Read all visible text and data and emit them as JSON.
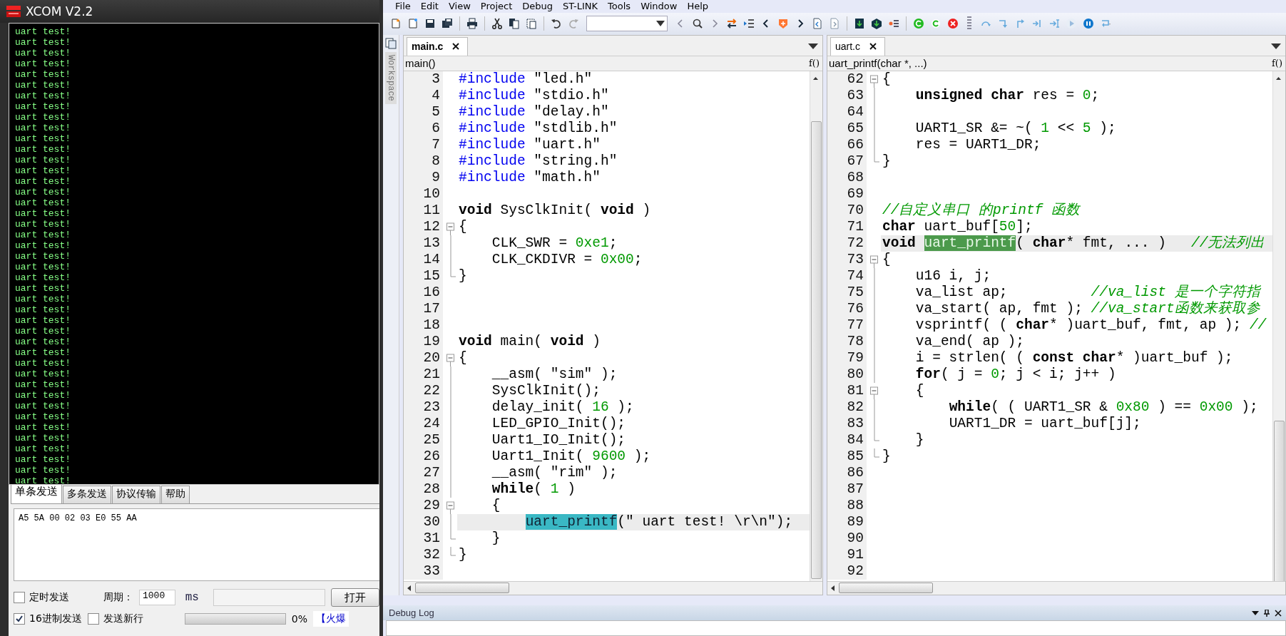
{
  "xcom": {
    "title": "XCOM V2.2",
    "terminal_lines": [
      "uart test!",
      "uart test!",
      "uart test!",
      "uart test!",
      "uart test!",
      "uart test!",
      "uart test!",
      "uart test!",
      "uart test!",
      "uart test!",
      "uart test!",
      "uart test!",
      "uart test!",
      "uart test!",
      "uart test!",
      "uart test!",
      "uart test!",
      "uart test!",
      "uart test!",
      "uart test!",
      "uart test!",
      "uart test!",
      "uart test!",
      "uart test!",
      "uart test!",
      "uart test!",
      "uart test!",
      "uart test!",
      "uart test!",
      "uart test!",
      "uart test!",
      "uart test!",
      "uart test!",
      "uart test!",
      "uart test!",
      "uart test!",
      "uart test!",
      "uart test!",
      "uart test!",
      "uart test!",
      "uart test!",
      "uart test!",
      "uart test!"
    ],
    "tabs": [
      {
        "label": "单条发送",
        "selected": true
      },
      {
        "label": "多条发送",
        "selected": false
      },
      {
        "label": "协议传输",
        "selected": false
      },
      {
        "label": "帮助",
        "selected": false
      }
    ],
    "send_text": "A5 5A 00 02 03 E0 55 AA",
    "timed_send": {
      "label": "定时发送",
      "checked": false
    },
    "period_label": "周期：",
    "period_value": "1000",
    "period_unit": "ms",
    "open_file_button": "打开",
    "hex_send": {
      "label": "16进制发送",
      "checked": true
    },
    "send_newline": {
      "label": "发送新行",
      "checked": false
    },
    "progress": {
      "level": 0,
      "reading": "0%"
    },
    "link": "【火爆"
  },
  "ide": {
    "menu": [
      "File",
      "Edit",
      "View",
      "Project",
      "Debug",
      "ST-LINK",
      "Tools",
      "Window",
      "Help"
    ],
    "workspace_label": "Workspace",
    "editors": [
      {
        "tab": {
          "label": "main.c",
          "selected": true
        },
        "function": "main()",
        "func_button": "f()",
        "lines": [
          {
            "no": "3",
            "kind": "plain",
            "segs": [
              {
                "kind": "pp",
                "text": "#include"
              },
              {
                "kind": "plain",
                "text": " \"led.h\""
              }
            ]
          },
          {
            "no": "4",
            "kind": "plain",
            "segs": [
              {
                "kind": "pp",
                "text": "#include"
              },
              {
                "kind": "plain",
                "text": " \"stdio.h\""
              }
            ]
          },
          {
            "no": "5",
            "kind": "plain",
            "segs": [
              {
                "kind": "pp",
                "text": "#include"
              },
              {
                "kind": "plain",
                "text": " \"delay.h\""
              }
            ]
          },
          {
            "no": "6",
            "kind": "plain",
            "segs": [
              {
                "kind": "pp",
                "text": "#include"
              },
              {
                "kind": "plain",
                "text": " \"stdlib.h\""
              }
            ]
          },
          {
            "no": "7",
            "kind": "plain",
            "segs": [
              {
                "kind": "pp",
                "text": "#include"
              },
              {
                "kind": "plain",
                "text": " \"uart.h\""
              }
            ]
          },
          {
            "no": "8",
            "kind": "plain",
            "segs": [
              {
                "kind": "pp",
                "text": "#include"
              },
              {
                "kind": "plain",
                "text": " \"string.h\""
              }
            ]
          },
          {
            "no": "9",
            "kind": "plain",
            "segs": [
              {
                "kind": "pp",
                "text": "#include"
              },
              {
                "kind": "plain",
                "text": " \"math.h\""
              }
            ]
          },
          {
            "no": "10",
            "kind": "plain"
          },
          {
            "no": "11",
            "kind": "plain",
            "segs": [
              {
                "kind": "kw",
                "text": "void"
              },
              {
                "kind": "plain",
                "text": " SysClkInit( "
              },
              {
                "kind": "kw",
                "text": "void"
              },
              {
                "kind": "plain",
                "text": " )"
              }
            ]
          },
          {
            "no": "12",
            "kind": "opener",
            "segs": [
              {
                "kind": "plain",
                "text": "{"
              }
            ]
          },
          {
            "no": "13",
            "kind": "inner",
            "segs": [
              {
                "kind": "plain",
                "text": "    CLK_SWR = "
              },
              {
                "kind": "num",
                "text": "0xe1"
              },
              {
                "kind": "plain",
                "text": ";"
              }
            ]
          },
          {
            "no": "14",
            "kind": "inner",
            "segs": [
              {
                "kind": "plain",
                "text": "    CLK_CKDIVR = "
              },
              {
                "kind": "num",
                "text": "0x00"
              },
              {
                "kind": "plain",
                "text": ";"
              }
            ]
          },
          {
            "no": "15",
            "kind": "closer",
            "segs": [
              {
                "kind": "plain",
                "text": "}"
              }
            ]
          },
          {
            "no": "16",
            "kind": "plain"
          },
          {
            "no": "17",
            "kind": "plain"
          },
          {
            "no": "18",
            "kind": "plain"
          },
          {
            "no": "19",
            "kind": "plain",
            "segs": [
              {
                "kind": "kw",
                "text": "void"
              },
              {
                "kind": "plain",
                "text": " main( "
              },
              {
                "kind": "kw",
                "text": "void"
              },
              {
                "kind": "plain",
                "text": " )"
              }
            ]
          },
          {
            "no": "20",
            "kind": "opener",
            "segs": [
              {
                "kind": "plain",
                "text": "{"
              }
            ]
          },
          {
            "no": "21",
            "kind": "inner",
            "segs": [
              {
                "kind": "plain",
                "text": "    __asm( \"sim\" );"
              }
            ]
          },
          {
            "no": "22",
            "kind": "inner",
            "segs": [
              {
                "kind": "plain",
                "text": "    SysClkInit();"
              }
            ]
          },
          {
            "no": "23",
            "kind": "inner",
            "segs": [
              {
                "kind": "plain",
                "text": "    delay_init( "
              },
              {
                "kind": "num",
                "text": "16"
              },
              {
                "kind": "plain",
                "text": " );"
              }
            ]
          },
          {
            "no": "24",
            "kind": "inner",
            "segs": [
              {
                "kind": "plain",
                "text": "    LED_GPIO_Init();"
              }
            ]
          },
          {
            "no": "25",
            "kind": "inner",
            "segs": [
              {
                "kind": "plain",
                "text": "    Uart1_IO_Init();"
              }
            ]
          },
          {
            "no": "26",
            "kind": "inner",
            "segs": [
              {
                "kind": "plain",
                "text": "    Uart1_Init( "
              },
              {
                "kind": "num",
                "text": "9600"
              },
              {
                "kind": "plain",
                "text": " );"
              }
            ]
          },
          {
            "no": "27",
            "kind": "inner",
            "segs": [
              {
                "kind": "plain",
                "text": "    __asm( \"rim\" );"
              }
            ]
          },
          {
            "no": "28",
            "kind": "inner",
            "segs": [
              {
                "kind": "kw",
                "text": "    while"
              },
              {
                "kind": "plain",
                "text": "( "
              },
              {
                "kind": "num",
                "text": "1"
              },
              {
                "kind": "plain",
                "text": " )"
              }
            ]
          },
          {
            "no": "29",
            "kind": "opener",
            "segs": [
              {
                "kind": "plain",
                "text": "    {"
              }
            ]
          },
          {
            "no": "30",
            "kind": "inner",
            "current": true,
            "segs": [
              {
                "kind": "match",
                "text": "        uart_printf"
              },
              {
                "kind": "plain",
                "text": "(\" uart test! \\r\\n\");"
              }
            ]
          },
          {
            "no": "31",
            "kind": "closer",
            "segs": [
              {
                "kind": "plain",
                "text": "    }"
              }
            ]
          },
          {
            "no": "32",
            "kind": "closer",
            "segs": [
              {
                "kind": "plain",
                "text": "}"
              }
            ]
          },
          {
            "no": "33",
            "kind": "plain"
          }
        ]
      },
      {
        "tab": {
          "label": "uart.c",
          "selected": true
        },
        "function": "uart_printf(char *, ...)",
        "func_button": "f()",
        "lines": [
          {
            "no": "62",
            "kind": "opener",
            "segs": [
              {
                "kind": "plain",
                "text": "{"
              }
            ]
          },
          {
            "no": "63",
            "kind": "inner",
            "segs": [
              {
                "kind": "kw",
                "text": "    unsigned char"
              },
              {
                "kind": "plain",
                "text": " res = "
              },
              {
                "kind": "num",
                "text": "0"
              },
              {
                "kind": "plain",
                "text": ";"
              }
            ]
          },
          {
            "no": "64",
            "kind": "inner"
          },
          {
            "no": "65",
            "kind": "inner",
            "segs": [
              {
                "kind": "plain",
                "text": "    UART1_SR &= ~( "
              },
              {
                "kind": "num",
                "text": "1"
              },
              {
                "kind": "plain",
                "text": " << "
              },
              {
                "kind": "num",
                "text": "5"
              },
              {
                "kind": "plain",
                "text": " );"
              }
            ]
          },
          {
            "no": "66",
            "kind": "inner",
            "segs": [
              {
                "kind": "plain",
                "text": "    res = UART1_DR;"
              }
            ]
          },
          {
            "no": "67",
            "kind": "closer",
            "segs": [
              {
                "kind": "plain",
                "text": "}"
              }
            ]
          },
          {
            "no": "68",
            "kind": "plain"
          },
          {
            "no": "69",
            "kind": "plain"
          },
          {
            "no": "70",
            "kind": "plain",
            "segs": [
              {
                "kind": "cmt",
                "text": "//自定义串口 的printf 函数"
              }
            ]
          },
          {
            "no": "71",
            "kind": "plain",
            "segs": [
              {
                "kind": "kw",
                "text": "char"
              },
              {
                "kind": "plain",
                "text": " uart_buf["
              },
              {
                "kind": "num",
                "text": "50"
              },
              {
                "kind": "plain",
                "text": "];"
              }
            ]
          },
          {
            "no": "72",
            "kind": "plain",
            "current": true,
            "segs": [
              {
                "kind": "kw",
                "text": "void"
              },
              {
                "kind": "selection",
                "text": " uart_printf"
              },
              {
                "kind": "plain",
                "text": "( "
              },
              {
                "kind": "kw",
                "text": "char"
              },
              {
                "kind": "plain",
                "text": "* fmt, ... )   "
              },
              {
                "kind": "cmt",
                "text": "//无法列出"
              }
            ]
          },
          {
            "no": "73",
            "kind": "opener",
            "segs": [
              {
                "kind": "plain",
                "text": "{"
              }
            ]
          },
          {
            "no": "74",
            "kind": "inner",
            "segs": [
              {
                "kind": "plain",
                "text": "    u16 i, j;"
              }
            ]
          },
          {
            "no": "75",
            "kind": "inner",
            "segs": [
              {
                "kind": "plain",
                "text": "    va_list ap;          "
              },
              {
                "kind": "cmt",
                "text": "//va_list 是一个字符指"
              }
            ]
          },
          {
            "no": "76",
            "kind": "inner",
            "segs": [
              {
                "kind": "plain",
                "text": "    va_start( ap, fmt ); "
              },
              {
                "kind": "cmt",
                "text": "//va_start函数来获取参"
              }
            ]
          },
          {
            "no": "77",
            "kind": "inner",
            "segs": [
              {
                "kind": "plain",
                "text": "    vsprintf( ( "
              },
              {
                "kind": "kw",
                "text": "char"
              },
              {
                "kind": "plain",
                "text": "* )uart_buf, fmt, ap ); "
              },
              {
                "kind": "cmt",
                "text": "//"
              }
            ]
          },
          {
            "no": "78",
            "kind": "inner",
            "segs": [
              {
                "kind": "plain",
                "text": "    va_end( ap );"
              }
            ]
          },
          {
            "no": "79",
            "kind": "inner",
            "segs": [
              {
                "kind": "plain",
                "text": "    i = strlen( ( "
              },
              {
                "kind": "kw",
                "text": "const char"
              },
              {
                "kind": "plain",
                "text": "* )uart_buf );"
              }
            ]
          },
          {
            "no": "80",
            "kind": "inner",
            "segs": [
              {
                "kind": "kw",
                "text": "    for"
              },
              {
                "kind": "plain",
                "text": "( j = "
              },
              {
                "kind": "num",
                "text": "0"
              },
              {
                "kind": "plain",
                "text": "; j < i; j++ )"
              }
            ]
          },
          {
            "no": "81",
            "kind": "opener",
            "segs": [
              {
                "kind": "plain",
                "text": "    {"
              }
            ]
          },
          {
            "no": "82",
            "kind": "inner",
            "segs": [
              {
                "kind": "kw",
                "text": "        while"
              },
              {
                "kind": "plain",
                "text": "( ( UART1_SR & "
              },
              {
                "kind": "num",
                "text": "0x80"
              },
              {
                "kind": "plain",
                "text": " ) == "
              },
              {
                "kind": "num",
                "text": "0x00"
              },
              {
                "kind": "plain",
                "text": " );"
              }
            ]
          },
          {
            "no": "83",
            "kind": "inner",
            "segs": [
              {
                "kind": "plain",
                "text": "        UART1_DR = uart_buf[j];"
              }
            ]
          },
          {
            "no": "84",
            "kind": "closer",
            "segs": [
              {
                "kind": "plain",
                "text": "    }"
              }
            ]
          },
          {
            "no": "85",
            "kind": "closer",
            "segs": [
              {
                "kind": "plain",
                "text": "}"
              }
            ]
          },
          {
            "no": "86",
            "kind": "plain"
          },
          {
            "no": "87",
            "kind": "plain"
          },
          {
            "no": "88",
            "kind": "plain"
          },
          {
            "no": "89",
            "kind": "plain"
          },
          {
            "no": "90",
            "kind": "plain"
          },
          {
            "no": "91",
            "kind": "plain"
          },
          {
            "no": "92",
            "kind": "plain"
          }
        ]
      }
    ],
    "debug_log": {
      "title": "Debug Log"
    }
  }
}
